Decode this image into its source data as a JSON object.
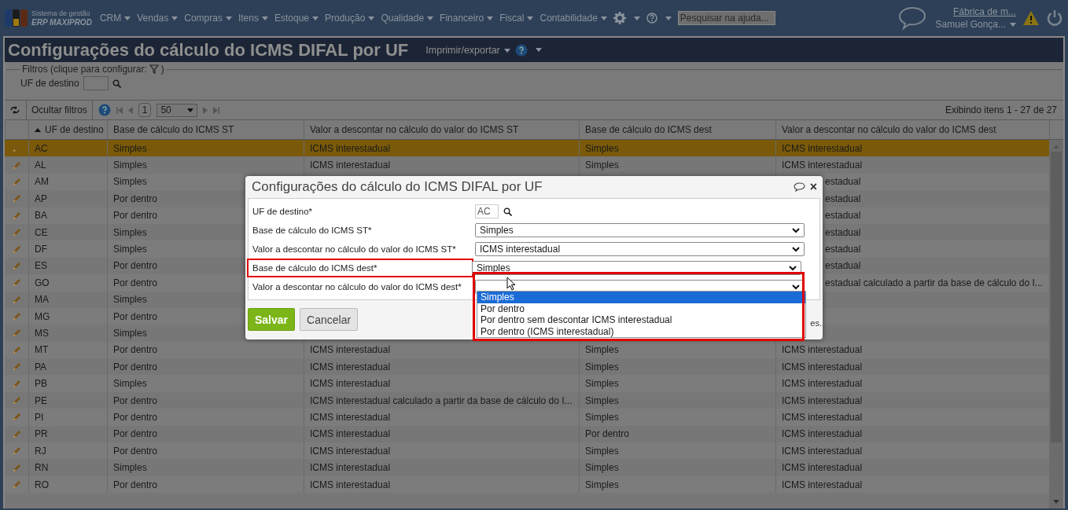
{
  "nav": {
    "brand_line1": "Sistema de gestão",
    "brand_line2": "ERP MAXIPROD",
    "menus": [
      "CRM",
      "Vendas",
      "Compras",
      "Itens",
      "Estoque",
      "Produção",
      "Qualidade",
      "Financeiro",
      "Fiscal",
      "Contabilidade"
    ],
    "search": {
      "placeholder": "Pesquisar na ajuda..."
    },
    "company_link": "Fábrica de m...",
    "user": "Samuel Gonça..."
  },
  "page": {
    "title": "Configurações do cálculo do ICMS DIFAL por UF",
    "export_menu": "Imprimir/exportar"
  },
  "filters": {
    "legend_start": "Filtros (clique para configurar:",
    "legend_end": ")",
    "fields": [
      {
        "label": "UF de destino"
      }
    ]
  },
  "toolbar": {
    "hide_filters": "Ocultar filtros",
    "page": "1",
    "page_size": "50",
    "summary": "Exibindo itens 1 - 27 de 27"
  },
  "table": {
    "columns": [
      {
        "label": "UF de destino",
        "sorted": true
      },
      {
        "label": "Base de cálculo do ICMS ST",
        "sorted": false
      },
      {
        "label": "Valor a descontar no cálculo do valor do ICMS ST",
        "sorted": false
      },
      {
        "label": "Base de cálculo do ICMS dest",
        "sorted": false
      },
      {
        "label": "Valor a descontar no cálculo do valor do ICMS dest",
        "sorted": false
      }
    ],
    "rows": [
      {
        "selected": true,
        "cells": [
          "AC",
          "Simples",
          "ICMS interestadual",
          "Simples",
          "ICMS interestadual"
        ]
      },
      {
        "selected": false,
        "cells": [
          "AL",
          "Simples",
          "ICMS interestadual",
          "Simples",
          "ICMS interestadual"
        ]
      },
      {
        "selected": false,
        "cells": [
          "AM",
          "Simples",
          null,
          null,
          "estadual"
        ]
      },
      {
        "selected": false,
        "cells": [
          "AP",
          "Por dentro",
          null,
          null,
          "estadual"
        ]
      },
      {
        "selected": false,
        "cells": [
          "BA",
          "Por dentro",
          null,
          null,
          "estadual"
        ]
      },
      {
        "selected": false,
        "cells": [
          "CE",
          "Simples",
          null,
          null,
          "estadual"
        ]
      },
      {
        "selected": false,
        "cells": [
          "DF",
          "Simples",
          null,
          null,
          "estadual"
        ]
      },
      {
        "selected": false,
        "cells": [
          "ES",
          "Por dentro",
          null,
          null,
          "estadual"
        ]
      },
      {
        "selected": false,
        "cells": [
          "GO",
          "Por dentro",
          null,
          null,
          "estadual calculado a partir da base de cálculo do I..."
        ]
      },
      {
        "selected": false,
        "cells": [
          "MA",
          "Simples",
          null,
          null,
          null
        ]
      },
      {
        "selected": false,
        "cells": [
          "MG",
          "Por dentro",
          null,
          null,
          null
        ]
      },
      {
        "selected": false,
        "cells": [
          "MS",
          "Simples",
          null,
          null,
          null
        ]
      },
      {
        "selected": false,
        "cells": [
          "MT",
          "Por dentro",
          "ICMS interestadual",
          "Simples",
          "ICMS interestadual"
        ]
      },
      {
        "selected": false,
        "cells": [
          "PA",
          "Por dentro",
          "ICMS interestadual",
          "Simples",
          "ICMS interestadual"
        ]
      },
      {
        "selected": false,
        "cells": [
          "PB",
          "Simples",
          "ICMS interestadual",
          "Simples",
          "ICMS interestadual"
        ]
      },
      {
        "selected": false,
        "cells": [
          "PE",
          "Por dentro",
          "ICMS interestadual calculado a partir da base de cálculo do I...",
          "Simples",
          "ICMS interestadual"
        ]
      },
      {
        "selected": false,
        "cells": [
          "PI",
          "Por dentro",
          "ICMS interestadual",
          "Simples",
          "ICMS interestadual"
        ]
      },
      {
        "selected": false,
        "cells": [
          "PR",
          "Por dentro",
          "ICMS interestadual",
          "Por dentro",
          "ICMS interestadual"
        ]
      },
      {
        "selected": false,
        "cells": [
          "RJ",
          "Por dentro",
          "ICMS interestadual",
          "Simples",
          "ICMS interestadual"
        ]
      },
      {
        "selected": false,
        "cells": [
          "RN",
          "Simples",
          "ICMS interestadual",
          "Simples",
          "ICMS interestadual"
        ]
      },
      {
        "selected": false,
        "cells": [
          "RO",
          "Por dentro",
          "ICMS interestadual",
          "Simples",
          "ICMS interestadual"
        ]
      }
    ]
  },
  "dialog": {
    "title": "Configurações do cálculo do ICMS DIFAL por UF",
    "close": "×",
    "fields": [
      {
        "kind": "lookup",
        "label": "UF de destino*",
        "value": "AC",
        "highlighted": false
      },
      {
        "kind": "select",
        "label": "Base de cálculo do ICMS ST*",
        "value": "Simples",
        "highlighted": false
      },
      {
        "kind": "select",
        "label": "Valor a descontar no cálculo do valor do ICMS ST*",
        "value": "ICMS interestadual",
        "highlighted": false
      },
      {
        "kind": "select",
        "label": "Base de cálculo do ICMS dest*",
        "value": "Simples",
        "highlighted": true,
        "options": [
          {
            "label": "Simples",
            "selected": true
          },
          {
            "label": "Por dentro",
            "selected": false
          },
          {
            "label": "Por dentro sem descontar ICMS interestadual",
            "selected": false
          },
          {
            "label": "Por dentro (ICMS interestadual)",
            "selected": false
          }
        ]
      },
      {
        "kind": "select",
        "label": "Valor a descontar no cálculo do valor do ICMS dest*",
        "highlighted": false
      }
    ],
    "buttons": [
      {
        "label": "Salvar",
        "kind": "primary"
      },
      {
        "label": "Cancelar",
        "kind": "secondary"
      }
    ],
    "note": "es."
  }
}
